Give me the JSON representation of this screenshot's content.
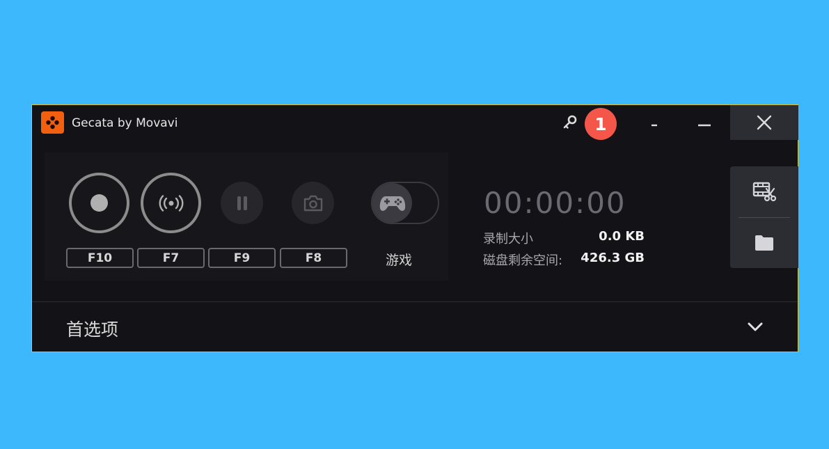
{
  "window": {
    "title": "Gecata by Movavi",
    "step_badge": "1"
  },
  "hotkeys": {
    "record": "F10",
    "stream": "F7",
    "pause": "F9",
    "screenshot": "F8"
  },
  "game_mode": {
    "label": "游戏"
  },
  "stats": {
    "timer": "00:00:00",
    "size_label": "录制大小",
    "size_value": "0.0 KB",
    "disk_label": "磁盘剩余空间:",
    "disk_value": "426.3 GB"
  },
  "preferences": {
    "label": "首选项"
  },
  "icons": {
    "logo": "gecata-logo-icon",
    "key": "key-icon",
    "minimize": "minimize-icon",
    "close": "close-icon",
    "record": "record-icon",
    "stream": "broadcast-icon",
    "pause": "pause-icon",
    "screenshot": "camera-icon",
    "game": "gamepad-icon",
    "edit": "film-scissors-icon",
    "folder": "folder-icon",
    "expand": "chevron-down-icon"
  },
  "colors": {
    "background": "#3db8fd",
    "window": "#131317",
    "accent": "#f25f0e",
    "badge": "#f4574a",
    "window_border": "#d9c22e"
  }
}
